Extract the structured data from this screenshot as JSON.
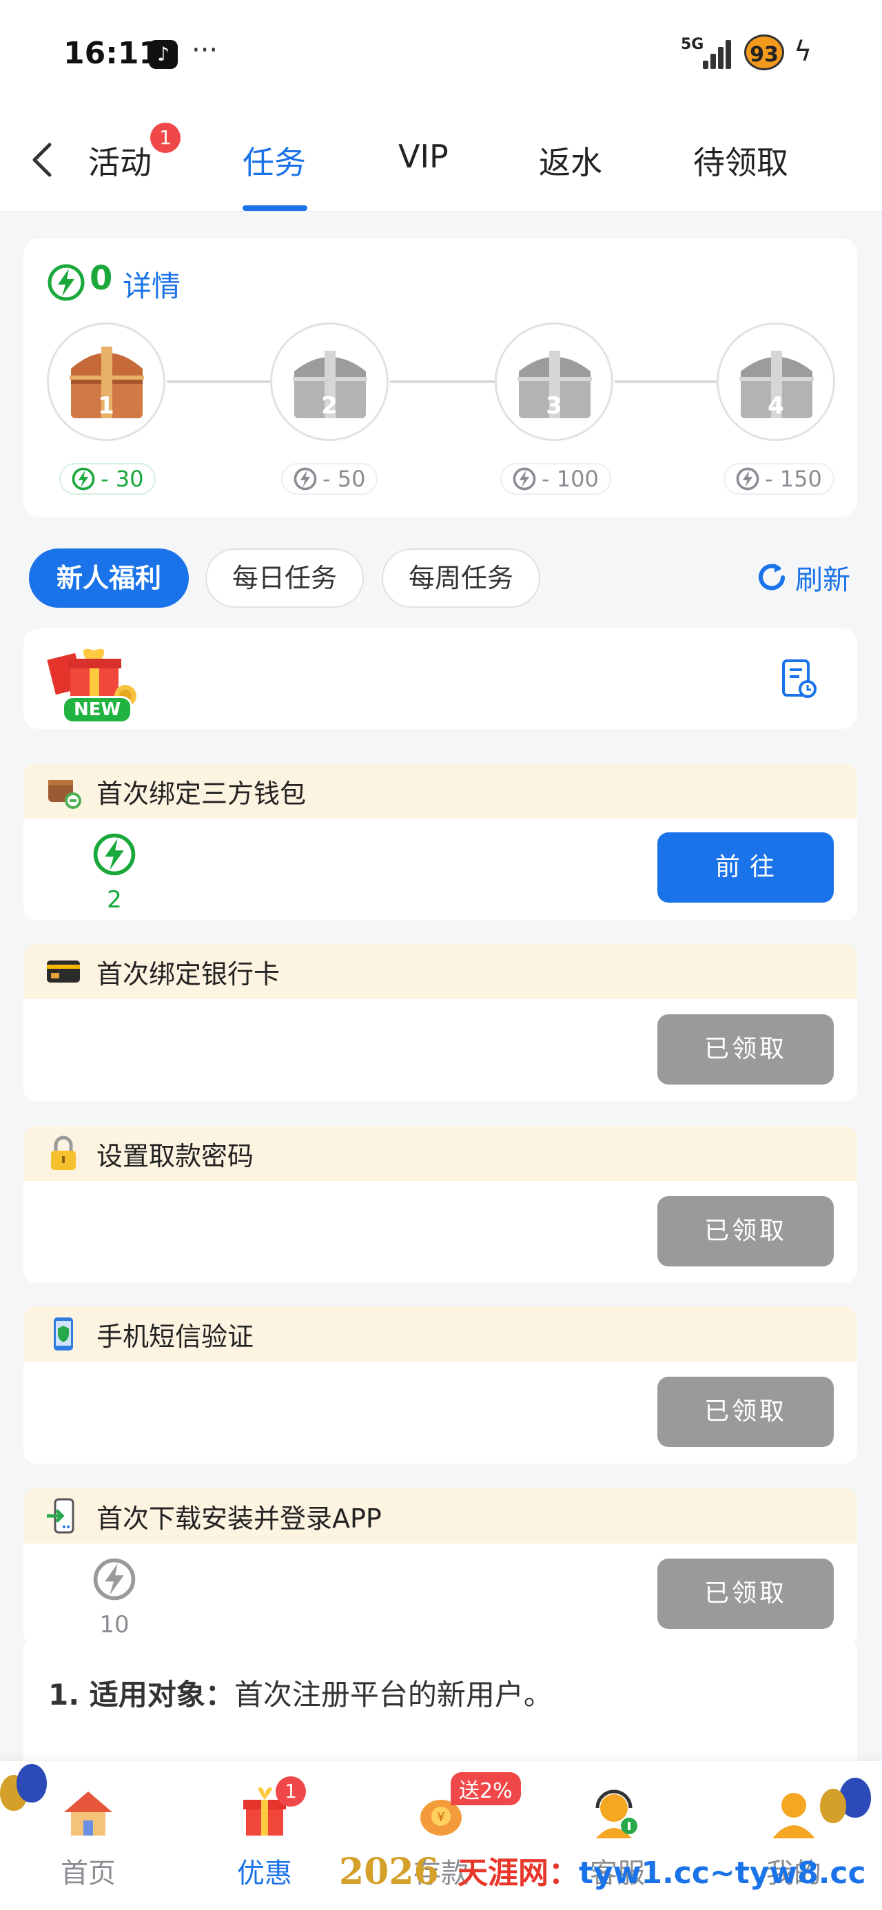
{
  "status_bar": {
    "time": "16:11",
    "more": "···",
    "network": "5G",
    "battery": "93"
  },
  "tabs": [
    {
      "label": "活动",
      "badge": "1"
    },
    {
      "label": "任务"
    },
    {
      "label": "VIP"
    },
    {
      "label": "返水"
    },
    {
      "label": "待领取"
    }
  ],
  "chest_card": {
    "points": "0",
    "details_label": "详情",
    "chests": [
      {
        "num": "1",
        "requirement": "- 30",
        "unlocked": true
      },
      {
        "num": "2",
        "requirement": "- 50",
        "unlocked": false
      },
      {
        "num": "3",
        "requirement": "- 100",
        "unlocked": false
      },
      {
        "num": "4",
        "requirement": "- 150",
        "unlocked": false
      }
    ]
  },
  "segments": [
    {
      "label": "新人福利",
      "active": true
    },
    {
      "label": "每日任务"
    },
    {
      "label": "每周任务"
    }
  ],
  "refresh_label": "刷新",
  "banner": {
    "new_tag": "NEW"
  },
  "tasks": [
    {
      "title": "首次绑定三方钱包",
      "icon": "wallet-link-icon",
      "reward": "2",
      "button": "前往",
      "state": "go"
    },
    {
      "title": "首次绑定银行卡",
      "icon": "bank-card-icon",
      "reward": "",
      "button": "已领取",
      "state": "done"
    },
    {
      "title": "设置取款密码",
      "icon": "lock-icon",
      "reward": "",
      "button": "已领取",
      "state": "done"
    },
    {
      "title": "手机短信验证",
      "icon": "phone-shield-icon",
      "reward": "",
      "button": "已领取",
      "state": "done"
    },
    {
      "title": "首次下载安装并登录APP",
      "icon": "phone-login-icon",
      "reward": "10",
      "button": "已领取",
      "state": "done"
    }
  ],
  "rules": {
    "label": "1. 适用对象：",
    "text": "首次注册平台的新用户。"
  },
  "bottom_nav": [
    {
      "label": "首页",
      "icon": "home-icon"
    },
    {
      "label": "优惠",
      "icon": "gift-icon",
      "badge": "1",
      "active": true
    },
    {
      "label": "存款",
      "icon": "deposit-icon",
      "promo": "送2%"
    },
    {
      "label": "客服",
      "icon": "support-icon"
    },
    {
      "label": "我的",
      "icon": "profile-icon"
    }
  ],
  "decoration": {
    "year": "2026"
  },
  "watermark": {
    "site": "天涯网",
    "sep": "：",
    "urls": "tyw1.cc~tyw8.cc"
  },
  "colors": {
    "primary": "#1a73e8",
    "green": "#1aa83a",
    "badge_red": "#f04848",
    "task_header_bg": "#fdf3e1",
    "done_gray": "#9a9a9a"
  }
}
